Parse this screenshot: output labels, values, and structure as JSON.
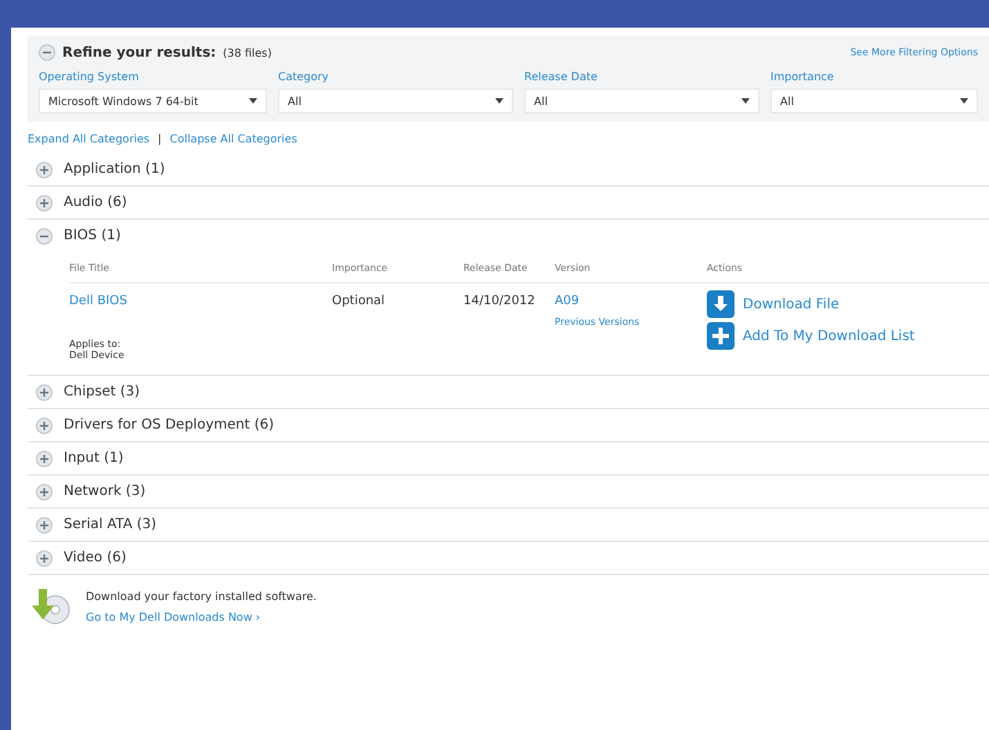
{
  "refine": {
    "title": "Refine your results:",
    "count": "(38 files)",
    "expanded": true,
    "more_link": "See More Filtering Options"
  },
  "filters": [
    {
      "label": "Operating System",
      "value": "Microsoft Windows 7 64-bit"
    },
    {
      "label": "Category",
      "value": "All"
    },
    {
      "label": "Release Date",
      "value": "All"
    },
    {
      "label": "Importance",
      "value": "All"
    }
  ],
  "expand_links": [
    "Expand All Categories",
    "|",
    "Collapse All Categories"
  ],
  "categories": [
    {
      "name": "Application (1)",
      "expanded": false
    },
    {
      "name": "Audio (6)",
      "expanded": false
    },
    {
      "name": "BIOS (1)",
      "expanded": true,
      "table": {
        "columns": [
          "File Title",
          "Importance",
          "Release Date",
          "Version",
          "Actions"
        ],
        "rows": [
          {
            "title": "Dell BIOS",
            "importance": "Optional",
            "date": "14/10/2012",
            "version": "A09",
            "previous": "Previous Versions",
            "applies": [
              "Applies to:",
              "Dell Device"
            ],
            "actions": [
              {
                "kind": "download",
                "label": "Download File"
              },
              {
                "kind": "add",
                "label": "Add To My Download List"
              }
            ]
          }
        ]
      }
    },
    {
      "name": "Chipset (3)",
      "expanded": false
    },
    {
      "name": "Drivers for OS Deployment (6)",
      "expanded": false
    },
    {
      "name": "Input (1)",
      "expanded": false
    },
    {
      "name": "Network (3)",
      "expanded": false
    },
    {
      "name": "Serial ATA (3)",
      "expanded": false
    },
    {
      "name": "Video (6)",
      "expanded": false
    }
  ],
  "footer": {
    "text": "Download your factory installed software.",
    "link": "Go to My Dell Downloads Now ›"
  }
}
